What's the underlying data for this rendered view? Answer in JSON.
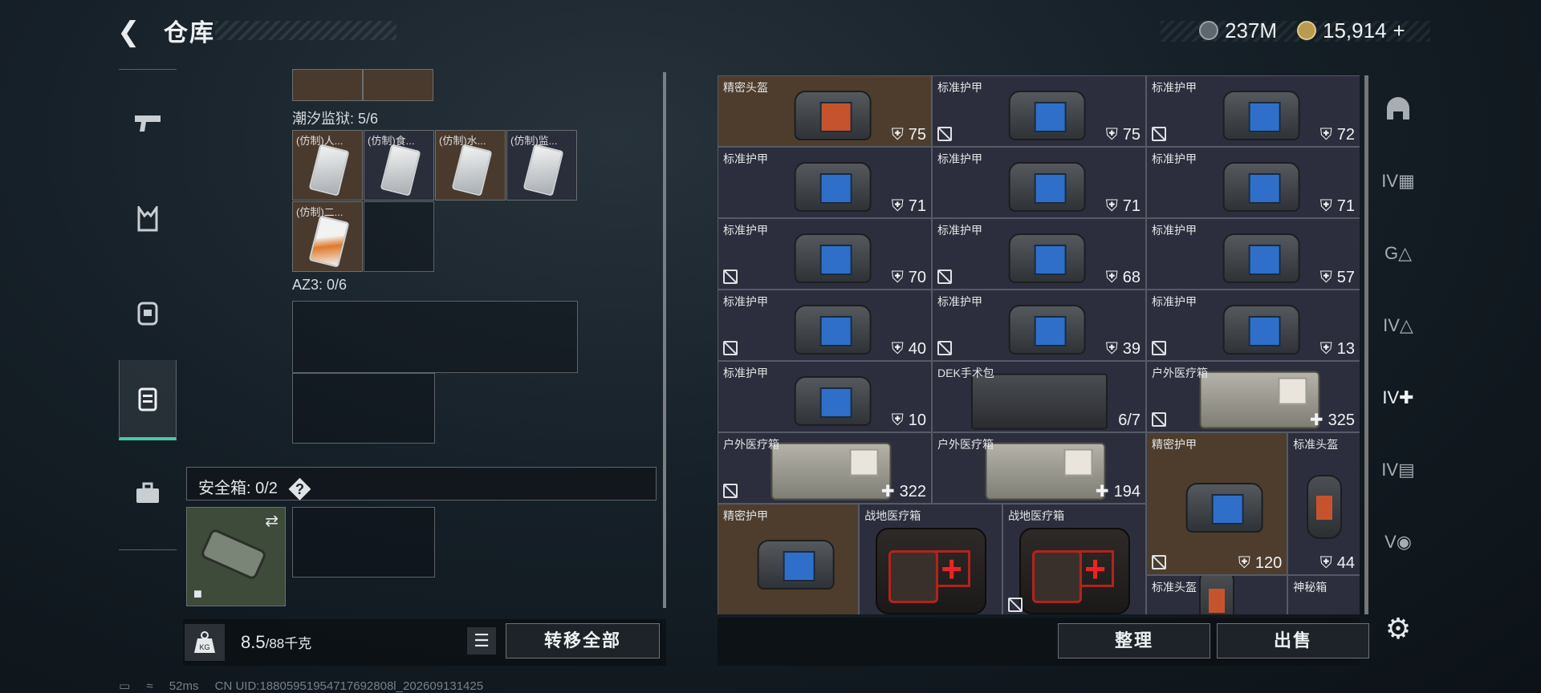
{
  "header": {
    "title": "仓库",
    "silver_amount": "237M",
    "gold_amount": "15,914",
    "gold_add": "+"
  },
  "left_nav": {
    "items": [
      {
        "name": "weapons",
        "icon": "pistol-icon"
      },
      {
        "name": "armor",
        "icon": "vest-icon"
      },
      {
        "name": "backpack",
        "icon": "backpack-icon"
      },
      {
        "name": "container",
        "icon": "container-icon",
        "active": true
      },
      {
        "name": "toolbox",
        "icon": "briefcase-icon"
      }
    ]
  },
  "inventory": {
    "section1_label": "潮汐监狱: 5/6",
    "section1_items": [
      "(仿制)人...",
      "(仿制)食...",
      "(仿制)水...",
      "(仿制)监...",
      "(仿制)二..."
    ],
    "section2_label": "AZ3: 0/6",
    "safe_label": "安全箱: 0/2",
    "safe_help": "?"
  },
  "bottom_left": {
    "weight_current": "8.5",
    "weight_max": "/88千克",
    "kg_label": "KG",
    "transfer_all": "转移全部"
  },
  "stash": {
    "items": [
      {
        "name": "精密头盔",
        "value": "75",
        "type": "helmet-vest",
        "kind": "armor"
      },
      {
        "name": "标准护甲",
        "value": "75",
        "type": "vest",
        "kind": "armor"
      },
      {
        "name": "标准护甲",
        "value": "72",
        "type": "vest",
        "kind": "armor"
      },
      {
        "name": "标准护甲",
        "value": "71",
        "type": "vest",
        "kind": "armor"
      },
      {
        "name": "标准护甲",
        "value": "71",
        "type": "vest",
        "kind": "armor"
      },
      {
        "name": "标准护甲",
        "value": "71",
        "type": "vest",
        "kind": "armor"
      },
      {
        "name": "标准护甲",
        "value": "70",
        "type": "vest",
        "kind": "armor"
      },
      {
        "name": "标准护甲",
        "value": "68",
        "type": "vest",
        "kind": "armor"
      },
      {
        "name": "标准护甲",
        "value": "57",
        "type": "vest",
        "kind": "armor"
      },
      {
        "name": "标准护甲",
        "value": "40",
        "type": "vest",
        "kind": "armor"
      },
      {
        "name": "标准护甲",
        "value": "39",
        "type": "vest",
        "kind": "armor"
      },
      {
        "name": "标准护甲",
        "value": "13",
        "type": "vest",
        "kind": "armor"
      },
      {
        "name": "标准护甲",
        "value": "10",
        "type": "vest",
        "kind": "armor"
      },
      {
        "name": "DEK手术包",
        "value": "6/7",
        "type": "dek",
        "kind": "count"
      },
      {
        "name": "户外医疗箱",
        "value": "325",
        "type": "kit",
        "kind": "heal"
      },
      {
        "name": "户外医疗箱",
        "value": "322",
        "type": "kit",
        "kind": "heal"
      },
      {
        "name": "户外医疗箱",
        "value": "194",
        "type": "kit",
        "kind": "heal"
      },
      {
        "name": "精密护甲",
        "value": "120",
        "type": "vest",
        "kind": "armor"
      },
      {
        "name": "标准头盔",
        "value": "44",
        "type": "helmet",
        "kind": "armor"
      },
      {
        "name": "精密护甲",
        "value": "",
        "type": "vest",
        "kind": "armor"
      },
      {
        "name": "战地医疗箱",
        "value": "",
        "type": "aid",
        "kind": "none"
      },
      {
        "name": "战地医疗箱",
        "value": "",
        "type": "aid",
        "kind": "none"
      },
      {
        "name": "标准头盔",
        "value": "",
        "type": "helmet",
        "kind": "none"
      },
      {
        "name": "神秘箱",
        "value": "",
        "type": "none",
        "kind": "none"
      }
    ]
  },
  "bottom_right": {
    "sort": "整理",
    "sell": "出售"
  },
  "right_nav": {
    "items": [
      {
        "name": "helmet",
        "icon": "helmet-icon"
      },
      {
        "name": "IV-armor",
        "icon": "tier-iv-armor-icon"
      },
      {
        "name": "ammo",
        "icon": "ammo-icon"
      },
      {
        "name": "IV-supplies",
        "icon": "tier-iv-icon"
      },
      {
        "name": "IV-medical",
        "icon": "medical-icon",
        "active": true
      },
      {
        "name": "IV-docs",
        "icon": "docs-icon"
      },
      {
        "name": "V-misc",
        "icon": "misc-icon"
      }
    ]
  },
  "status_bar": {
    "ping": "52ms",
    "uid": "CN UID:18805951954717692808l_202609131425"
  },
  "colors": {
    "accent": "#46c9a4",
    "gold_cell": "#4e3d2d",
    "purple_cell": "#2c2e3d"
  }
}
